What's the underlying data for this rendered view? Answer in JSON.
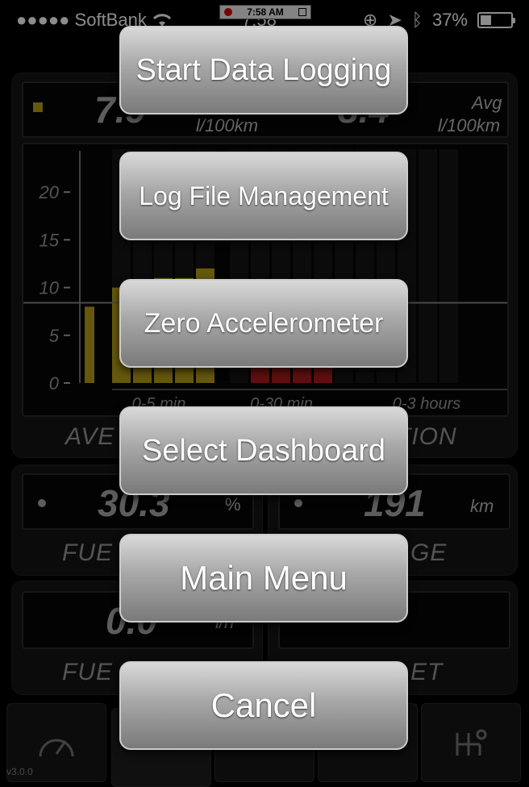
{
  "status": {
    "carrier": "●●●●● SoftBank",
    "time": "7:58",
    "battery": "37%",
    "battery_level": 0.37,
    "rec_time": "7:58 AM"
  },
  "top_gauge": {
    "value_left": "7.9",
    "unit_left": "l/100km",
    "avg": "Avg",
    "value_right": "8.4",
    "unit_right": "l/100km"
  },
  "chart_data": {
    "type": "bar",
    "yticks": [
      "20",
      "15",
      "10",
      "5",
      "0"
    ],
    "ylim": [
      0,
      25
    ],
    "sections": [
      "0-5 min",
      "0-30 min",
      "0-3 hours"
    ],
    "current": 8,
    "series": [
      {
        "values": [
          10,
          10,
          11,
          11,
          12
        ],
        "color": "#b8a017"
      },
      {
        "values": [
          0,
          4,
          4,
          4,
          4,
          0,
          0,
          0
        ],
        "color": "#b01a1a"
      },
      {
        "values": [
          0,
          0,
          0,
          0,
          0
        ],
        "color": "#1a1a1a"
      }
    ]
  },
  "main_label": {
    "left": "AVE",
    "right": "TION"
  },
  "fuel_panel": {
    "value": "30.3",
    "unit": "%",
    "label": "FUE"
  },
  "range_panel": {
    "value": "191",
    "unit": "km",
    "label": "GE"
  },
  "flow_panel": {
    "value": "0.0",
    "unit": "l/h",
    "label": "FUE"
  },
  "trip_panel": {
    "label": "ET"
  },
  "menu": {
    "start_logging": "Start Data Logging",
    "log_files": "Log File Management",
    "zero_accel": "Zero Accelerometer",
    "select_dashboard": "Select Dashboard",
    "main_menu": "Main Menu",
    "cancel": "Cancel"
  },
  "version": "v3.0.0"
}
